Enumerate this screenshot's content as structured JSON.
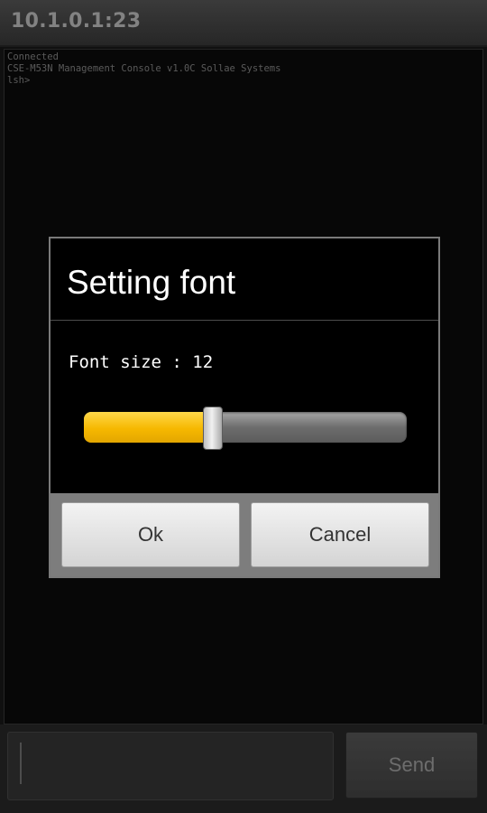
{
  "title_bar": {
    "title": "10.1.0.1:23"
  },
  "terminal": {
    "lines": [
      "Connected",
      "CSE-M53N Management Console v1.0C Sollae Systems",
      "lsh>"
    ]
  },
  "dialog": {
    "title": "Setting font",
    "font_size_label": "Font size : 12",
    "slider": {
      "value": 12,
      "fill_fraction": 0.4
    },
    "ok_label": "Ok",
    "cancel_label": "Cancel"
  },
  "input_bar": {
    "input_value": "",
    "send_label": "Send"
  },
  "colors": {
    "accent": "#f6b800",
    "background": "#000000"
  }
}
